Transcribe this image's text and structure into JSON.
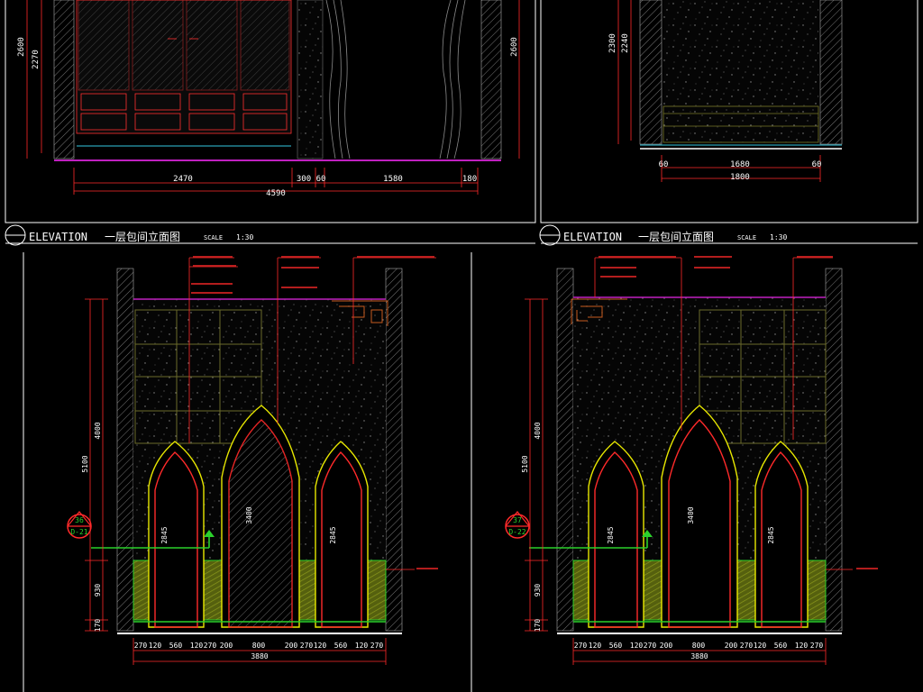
{
  "colors": {
    "bg": "#000000",
    "frame": "#ffffff",
    "dim": "#ff2a2a",
    "wall": "#888888",
    "wallfill": "#3a3a3a",
    "yellow": "#e8e800",
    "green": "#2bd12b",
    "lime": "#7cff00",
    "cyan": "#33c8e0",
    "magenta": "#c020c0",
    "olive": "#7a7a2a",
    "orange": "#c85a1e",
    "greenfill": "#7c8c14"
  },
  "panels": {
    "top_left": {
      "title_prefix": "ELEVATION",
      "title_cn": "一层包间立面图",
      "scale_label": "SCALE",
      "scale_value": "1:30",
      "heights": {
        "left_total": "2600",
        "left_inner": "2270",
        "right_total": "2600"
      },
      "bottom_widths": [
        "2470",
        "300",
        "60",
        "1580",
        "180"
      ],
      "total_width": "4590"
    },
    "top_right": {
      "title_prefix": "ELEVATION",
      "title_cn": "一层包间立面图",
      "scale_label": "SCALE",
      "scale_value": "1:30",
      "heights": {
        "total": "2300",
        "inner": "2240"
      },
      "bottom_widths": [
        "60",
        "1680",
        "60"
      ],
      "total_width": "1800"
    },
    "bottom_left": {
      "heights": {
        "h1": "4000",
        "h2": "5100",
        "h3": "930",
        "h4": "170"
      },
      "arch_heights": [
        "2845",
        "3400",
        "2845"
      ],
      "marker_top": "36",
      "marker_bottom": "D-21",
      "bottom_widths": [
        "270",
        "120",
        "560",
        "120",
        "270",
        "200",
        "800",
        "200",
        "270",
        "120",
        "560",
        "120",
        "270"
      ],
      "total_width": "3880"
    },
    "bottom_right": {
      "heights": {
        "h1": "4000",
        "h2": "5100",
        "h3": "930",
        "h4": "170"
      },
      "arch_heights": [
        "2845",
        "3400",
        "2845"
      ],
      "marker_top": "37",
      "marker_bottom": "D-22",
      "bottom_widths": [
        "270",
        "120",
        "560",
        "120",
        "270",
        "200",
        "800",
        "200",
        "270",
        "120",
        "560",
        "120",
        "270"
      ],
      "total_width": "3880"
    }
  }
}
